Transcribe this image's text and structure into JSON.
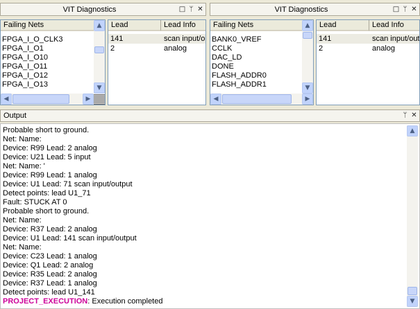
{
  "left_panel": {
    "title": "VIT Diagnostics",
    "failing_nets_header": "Failing Nets",
    "failing_nets": [
      "FPGA_I_O_CLK3",
      "FPGA_I_O1",
      "FPGA_I_O10",
      "FPGA_I_O11",
      "FPGA_I_O12",
      "FPGA_I_O13"
    ],
    "lead_header": "Lead",
    "lead_info_header": "Lead Info",
    "leads": [
      {
        "lead": "141",
        "info": "scan input/output"
      },
      {
        "lead": "2",
        "info": "analog"
      }
    ]
  },
  "right_panel": {
    "title": "VIT Diagnostics",
    "failing_nets_header": "Failing Nets",
    "failing_nets": [
      "BANK0_VREF",
      "CCLK",
      "DAC_LD",
      "DONE",
      "FLASH_ADDR0",
      "FLASH_ADDR1"
    ],
    "lead_header": "Lead",
    "lead_info_header": "Lead Info",
    "leads": [
      {
        "lead": "141",
        "info": "scan input/output"
      },
      {
        "lead": "2",
        "info": "analog"
      }
    ]
  },
  "output_panel": {
    "title": "Output",
    "lines": [
      "Probable short to ground.",
      "Net: Name:",
      "Device: R99  Lead: 2  analog",
      "Device: U21  Lead: 5  input",
      "Net: Name: '",
      "Device: R99  Lead: 1  analog",
      "Device: U1  Lead: 71  scan input/output",
      "Detect points: lead U1_71",
      "Fault: STUCK AT 0",
      "Probable short to ground.",
      "Net: Name:",
      "Device: R37  Lead: 2  analog",
      "Device: U1  Lead: 141  scan input/output",
      "Net: Name:",
      "Device: C23  Lead: 1  analog",
      "Device: Q1  Lead: 2  analog",
      "Device: R35  Lead: 2  analog",
      "Device: R37  Lead: 1  analog",
      "Detect points: lead U1_141"
    ],
    "final_keyword": "PROJECT_EXECUTION",
    "final_message": ": Execution completed"
  },
  "icons": {
    "restore": "restore-icon",
    "pin": "pin-icon",
    "close": "close-icon"
  },
  "colors": {
    "keyword": "#cc0099",
    "selection": "#ecebe2"
  }
}
